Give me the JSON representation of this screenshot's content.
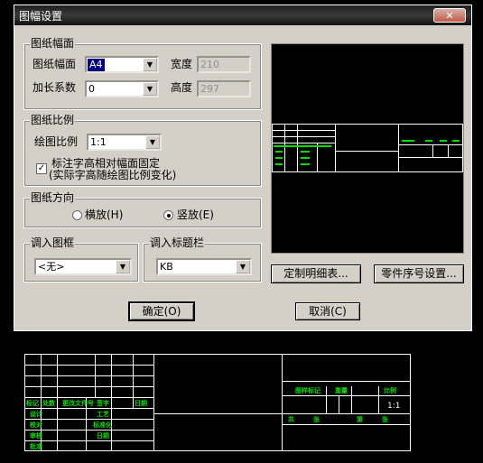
{
  "dialog": {
    "title": "图幅设置",
    "close_icon": "close-x-icon"
  },
  "paper_size_group": {
    "legend": "图纸幅面",
    "size_label": "图纸幅面",
    "size_value": "A4",
    "extension_label": "加长系数",
    "extension_value": "0",
    "width_label": "宽度",
    "width_value": "210",
    "height_label": "高度",
    "height_value": "297"
  },
  "scale_group": {
    "legend": "图纸比例",
    "scale_label": "绘图比例",
    "scale_value": "1:1",
    "fixed_text_checked": true,
    "fixed_text_label_1": "标注字高相对幅面固定",
    "fixed_text_label_2": "(实际字高随绘图比例变化)"
  },
  "orientation_group": {
    "legend": "图纸方向",
    "landscape_label": "横放(H)",
    "portrait_label": "竖放(E)",
    "selected": "portrait"
  },
  "frame_group": {
    "legend": "调入图框",
    "value": "<无>"
  },
  "titleblock_group": {
    "legend": "调入标题栏",
    "value": "KB"
  },
  "buttons": {
    "custom_detail_table": "定制明细表...",
    "part_number_settings": "零件序号设置...",
    "ok": "确定(O)",
    "cancel": "取消(C)"
  },
  "title_block_preview": {
    "scale_text": "1:1",
    "row_headers": [
      "标记",
      "处数",
      "更改文件号",
      "签字",
      "日期"
    ],
    "left_labels": [
      "设计",
      "校对",
      "审核",
      "批准"
    ],
    "mid_labels": [
      "工艺",
      "标准化",
      "日期"
    ],
    "right_header": [
      "图样标记",
      "重量",
      "比例"
    ],
    "sheet_labels": [
      "共",
      "张",
      "第",
      "张"
    ]
  },
  "colors": {
    "dialog_bg": "#d4d0c8",
    "preview_bg": "#000000",
    "line_white": "#ffffff",
    "label_green": "#00e000"
  }
}
